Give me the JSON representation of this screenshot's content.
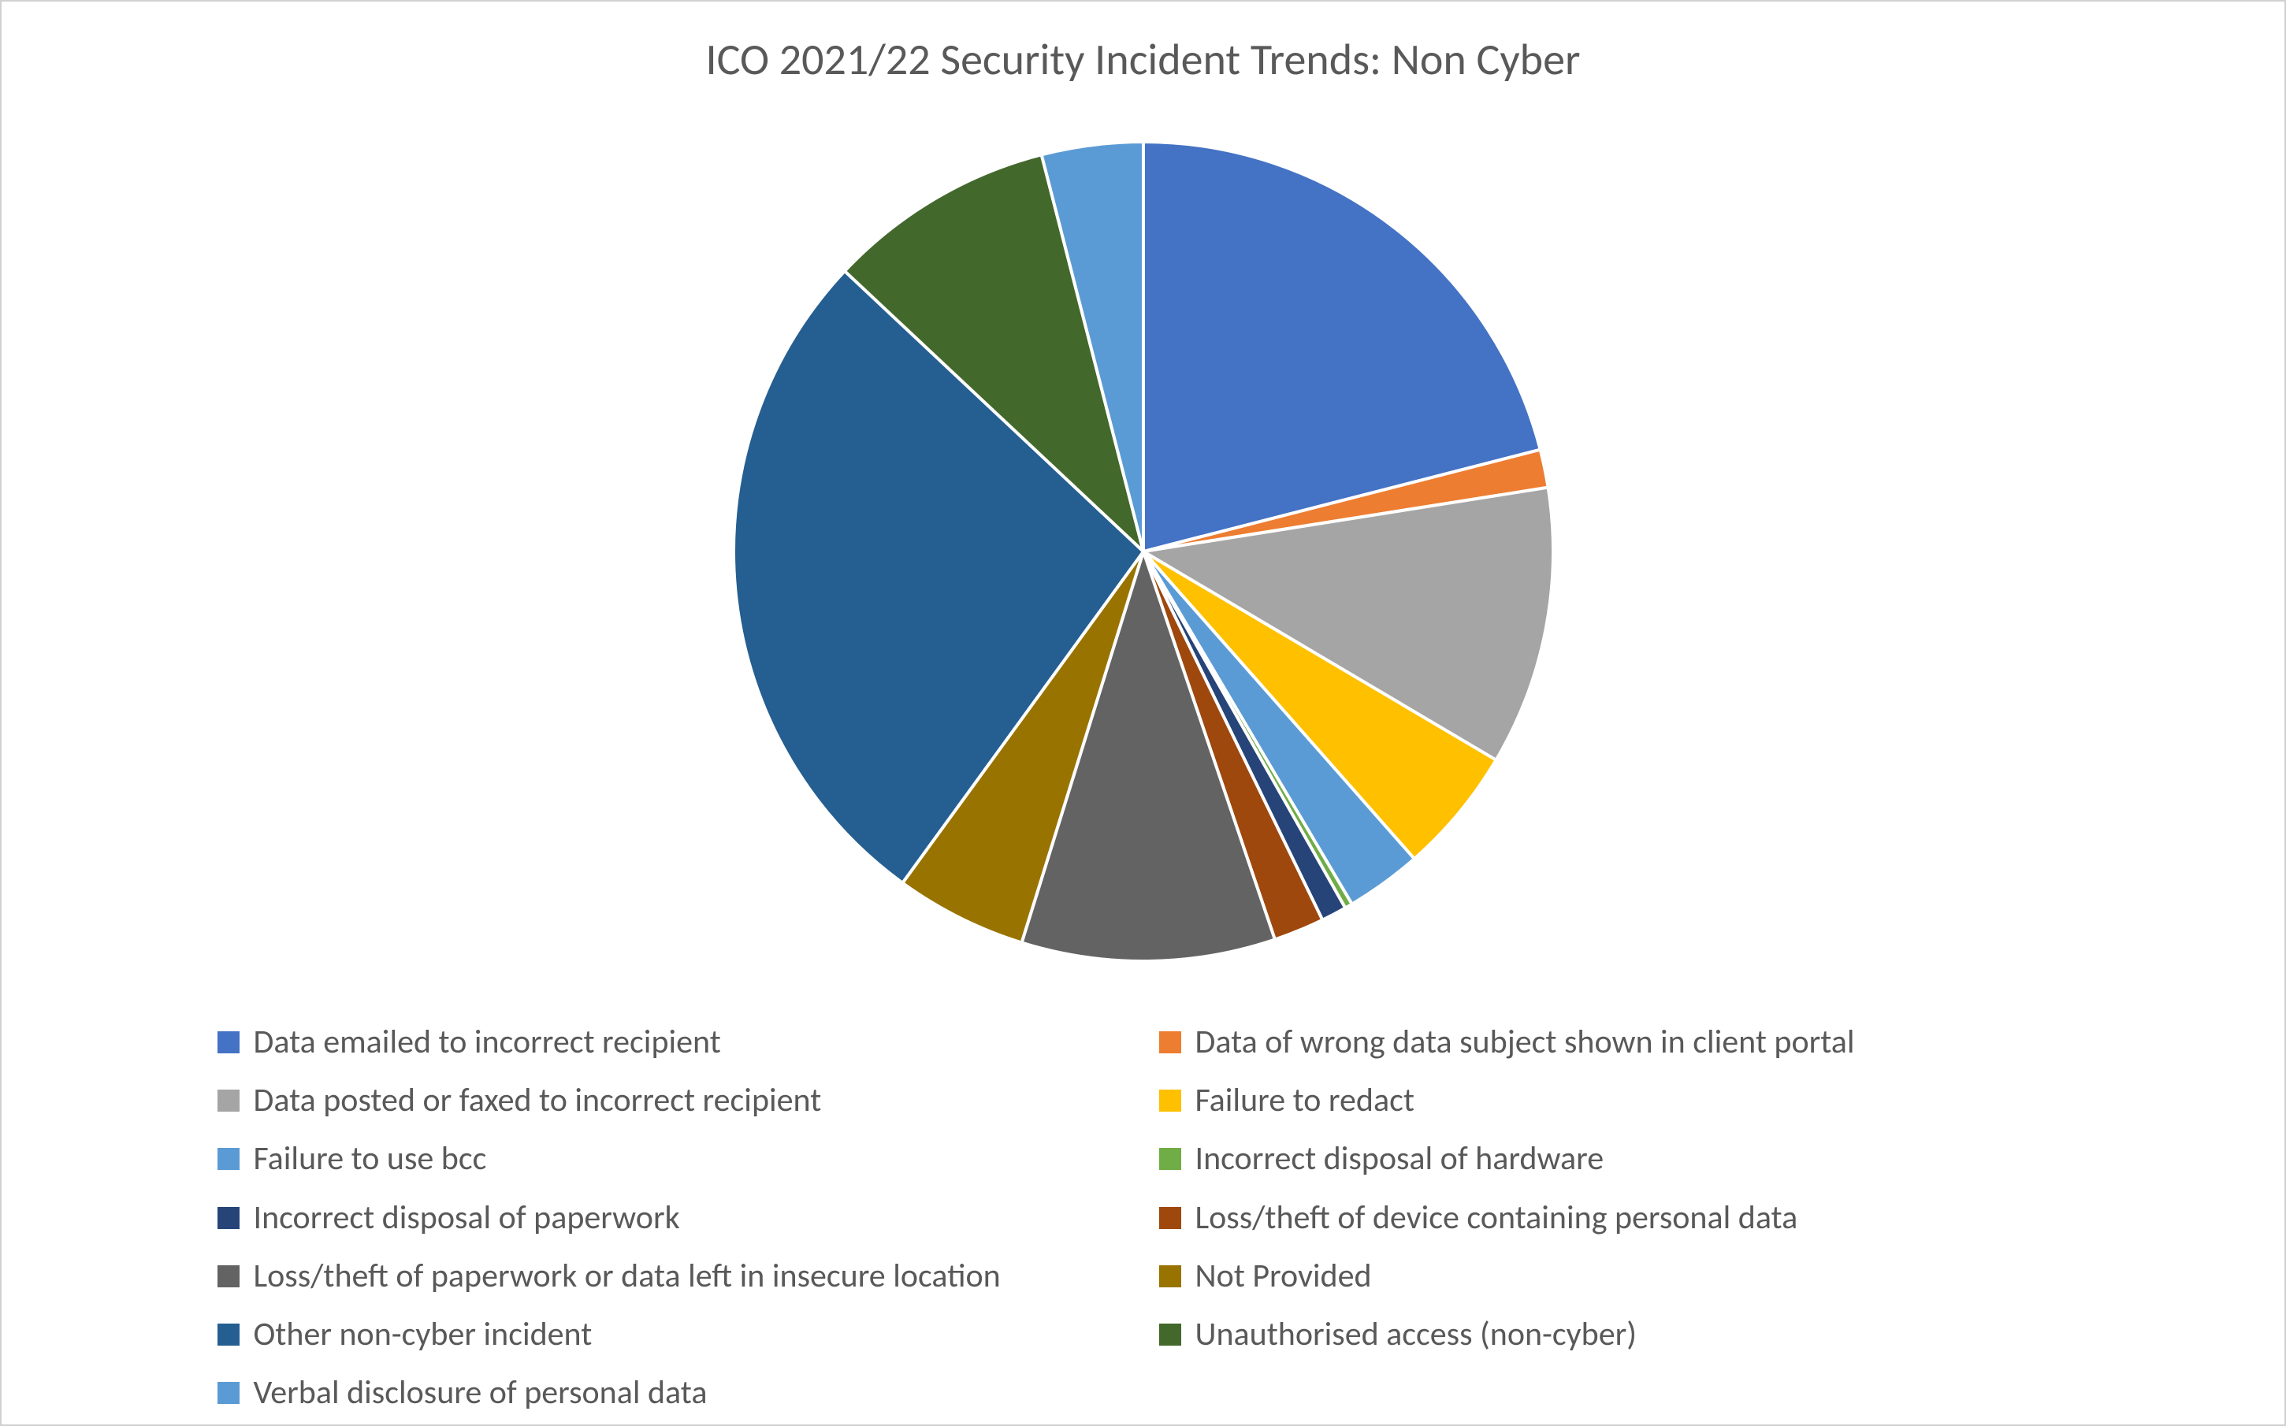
{
  "chart_data": {
    "type": "pie",
    "title": "ICO 2021/22 Security Incident Trends: Non Cyber",
    "series": [
      {
        "name": "Data emailed to incorrect recipient",
        "value": 21.0,
        "color": "#4472c4"
      },
      {
        "name": "Data of wrong data subject shown in client portal",
        "value": 1.5,
        "color": "#ed7d31"
      },
      {
        "name": "Data posted or faxed to incorrect recipient",
        "value": 11.0,
        "color": "#a5a5a5"
      },
      {
        "name": "Failure to redact",
        "value": 5.0,
        "color": "#ffc000"
      },
      {
        "name": "Failure to use bcc",
        "value": 3.0,
        "color": "#5b9bd5"
      },
      {
        "name": "Incorrect disposal of hardware",
        "value": 0.3,
        "color": "#70ad47"
      },
      {
        "name": "Incorrect disposal of paperwork",
        "value": 1.0,
        "color": "#264478"
      },
      {
        "name": "Loss/theft of device containing personal data",
        "value": 2.0,
        "color": "#9e480e"
      },
      {
        "name": "Loss/theft of paperwork or data left in insecure location",
        "value": 10.0,
        "color": "#636363"
      },
      {
        "name": "Not Provided",
        "value": 5.2,
        "color": "#997300"
      },
      {
        "name": "Other non-cyber incident",
        "value": 27.0,
        "color": "#255e91"
      },
      {
        "name": "Unauthorised access (non-cyber)",
        "value": 9.0,
        "color": "#43682b"
      },
      {
        "name": "Verbal disclosure of personal data",
        "value": 4.0,
        "color": "#5b9bd5"
      }
    ]
  }
}
